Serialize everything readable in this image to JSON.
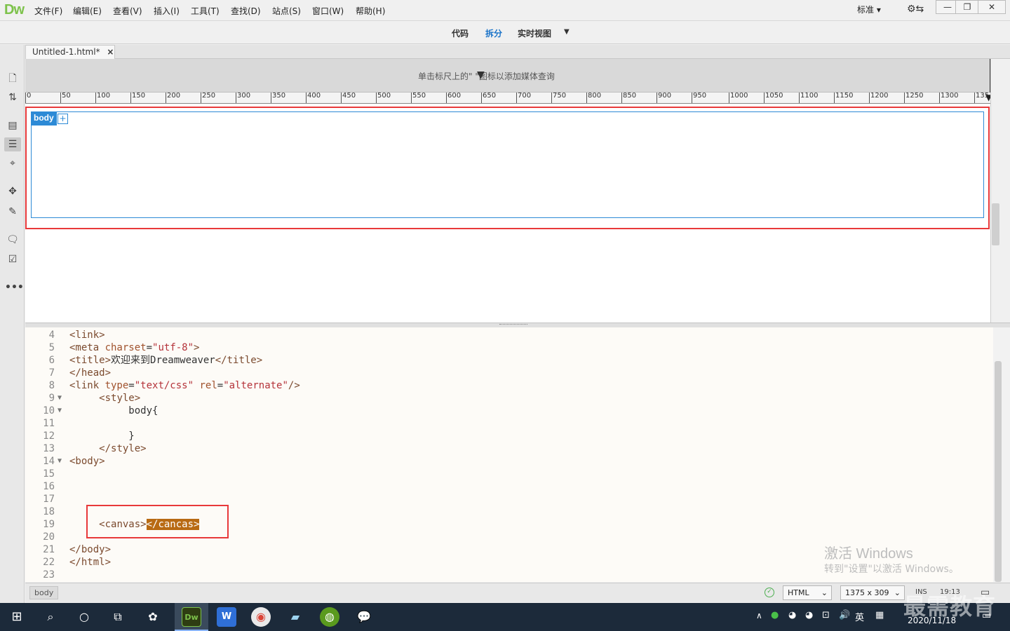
{
  "app": {
    "logo": "Dw"
  },
  "menu": [
    "文件(F)",
    "编辑(E)",
    "查看(V)",
    "插入(I)",
    "工具(T)",
    "查找(D)",
    "站点(S)",
    "窗口(W)",
    "帮助(H)"
  ],
  "layout_select": "标准",
  "view_buttons": {
    "code": "代码",
    "split": "拆分",
    "live": "实时视图"
  },
  "doc_tab": {
    "title": "Untitled-1.html*",
    "close": "×"
  },
  "media_query_hint": "单击标尺上的\"  \"图标以添加媒体查询",
  "ruler_labels": [
    "0",
    "50",
    "100",
    "150",
    "200",
    "250",
    "300",
    "350",
    "400",
    "450",
    "500",
    "550",
    "600",
    "650",
    "700",
    "750",
    "800",
    "850",
    "900",
    "950",
    "1000",
    "1050",
    "1100",
    "1150",
    "1200",
    "1250",
    "1300",
    "135"
  ],
  "design_view": {
    "body_tag": "body",
    "plus": "+"
  },
  "code_lines": [
    {
      "n": "4",
      "fold": "",
      "parts": [
        [
          "t-tag",
          "<link>"
        ]
      ]
    },
    {
      "n": "5",
      "fold": "",
      "parts": [
        [
          "t-tag",
          "<meta "
        ],
        [
          "t-attr",
          "charset"
        ],
        [
          "t-plain",
          "="
        ],
        [
          "t-str",
          "\"utf-8\""
        ],
        [
          "t-tag",
          ">"
        ]
      ]
    },
    {
      "n": "6",
      "fold": "",
      "parts": [
        [
          "t-tag",
          "<title>"
        ],
        [
          "t-plain",
          "欢迎来到Dreamweaver"
        ],
        [
          "t-tag",
          "</title>"
        ]
      ]
    },
    {
      "n": "7",
      "fold": "",
      "parts": [
        [
          "t-tag",
          "</head>"
        ]
      ]
    },
    {
      "n": "8",
      "fold": "",
      "parts": [
        [
          "t-tag",
          "<link "
        ],
        [
          "t-attr",
          "type"
        ],
        [
          "t-plain",
          "="
        ],
        [
          "t-str",
          "\"text/css\""
        ],
        [
          "t-plain",
          " "
        ],
        [
          "t-attr",
          "rel"
        ],
        [
          "t-plain",
          "="
        ],
        [
          "t-str",
          "\"alternate\""
        ],
        [
          "t-tag",
          "/>"
        ]
      ]
    },
    {
      "n": "9",
      "fold": "▼",
      "parts": [
        [
          "t-plain",
          "     "
        ],
        [
          "t-tag",
          "<style>"
        ]
      ]
    },
    {
      "n": "10",
      "fold": "▼",
      "parts": [
        [
          "t-plain",
          "          body{"
        ]
      ]
    },
    {
      "n": "11",
      "fold": "",
      "parts": []
    },
    {
      "n": "12",
      "fold": "",
      "parts": [
        [
          "t-plain",
          "          }"
        ]
      ]
    },
    {
      "n": "13",
      "fold": "",
      "parts": [
        [
          "t-plain",
          "     "
        ],
        [
          "t-tag",
          "</style>"
        ]
      ]
    },
    {
      "n": "14",
      "fold": "▼",
      "parts": [
        [
          "t-tag",
          "<body>"
        ]
      ]
    },
    {
      "n": "15",
      "fold": "",
      "parts": []
    },
    {
      "n": "16",
      "fold": "",
      "parts": []
    },
    {
      "n": "17",
      "fold": "",
      "parts": []
    },
    {
      "n": "18",
      "fold": "",
      "parts": []
    },
    {
      "n": "19",
      "fold": "",
      "parts": [
        [
          "t-plain",
          "     "
        ],
        [
          "t-tag",
          "<canvas>"
        ],
        [
          "hl",
          "</cancas>"
        ]
      ]
    },
    {
      "n": "20",
      "fold": "",
      "parts": []
    },
    {
      "n": "21",
      "fold": "",
      "parts": [
        [
          "t-tag",
          "</body>"
        ]
      ]
    },
    {
      "n": "22",
      "fold": "",
      "parts": [
        [
          "t-tag",
          "</html>"
        ]
      ]
    },
    {
      "n": "23",
      "fold": "",
      "parts": []
    }
  ],
  "watermark": {
    "line1": "激活 Windows",
    "line2": "转到\"设置\"以激活 Windows。"
  },
  "status": {
    "tag": "body",
    "doc_type": "HTML",
    "size": "1375 x 309",
    "mode": "INS",
    "pos": "19:13"
  },
  "taskbar": {
    "date": "2020/11/18",
    "lang": "英",
    "brand": "最需教育"
  }
}
